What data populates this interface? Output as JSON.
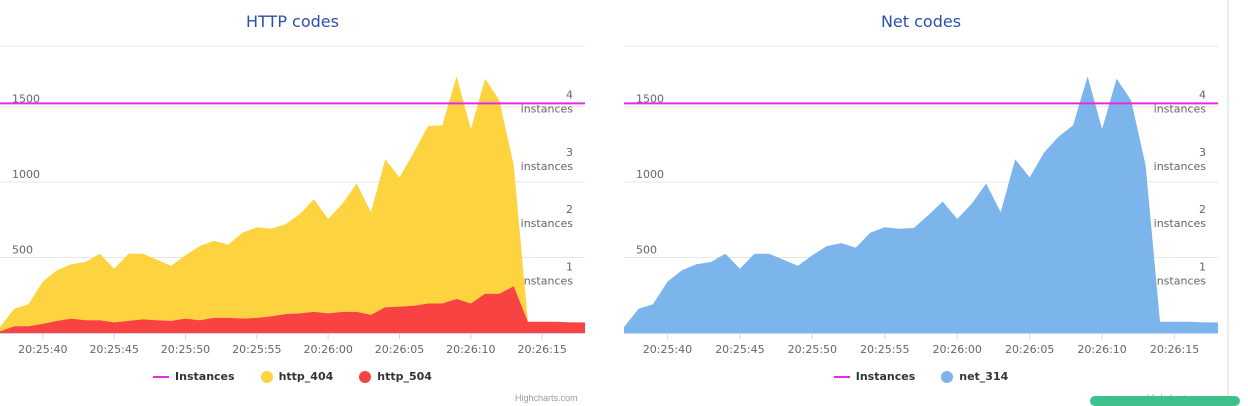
{
  "chart_data": [
    {
      "type": "area",
      "title": "HTTP codes",
      "x": [
        "20:25:37",
        "20:25:38",
        "20:25:39",
        "20:25:40",
        "20:25:41",
        "20:25:42",
        "20:25:43",
        "20:25:44",
        "20:25:45",
        "20:25:46",
        "20:25:47",
        "20:25:48",
        "20:25:49",
        "20:25:50",
        "20:25:51",
        "20:25:52",
        "20:25:53",
        "20:25:54",
        "20:25:55",
        "20:25:56",
        "20:25:57",
        "20:25:58",
        "20:25:59",
        "20:26:00",
        "20:26:01",
        "20:26:02",
        "20:26:03",
        "20:26:04",
        "20:26:05",
        "20:26:06",
        "20:26:07",
        "20:26:08",
        "20:26:09",
        "20:26:10",
        "20:26:11",
        "20:26:12",
        "20:26:13",
        "20:26:14",
        "20:26:15",
        "20:26:16",
        "20:26:17",
        "20:26:18"
      ],
      "x_ticks": [
        "20:25:40",
        "20:25:45",
        "20:25:50",
        "20:25:55",
        "20:26:00",
        "20:26:05",
        "20:26:10",
        "20:26:15"
      ],
      "y_ticks": [
        "500",
        "1000",
        "1500"
      ],
      "ylim": [
        0,
        1900
      ],
      "stacking": "normal",
      "series": [
        {
          "name": "http_504",
          "color": "#f94242",
          "values": [
            10,
            45,
            45,
            60,
            80,
            95,
            85,
            85,
            70,
            80,
            90,
            85,
            80,
            95,
            85,
            100,
            100,
            95,
            100,
            110,
            125,
            130,
            140,
            130,
            140,
            140,
            120,
            170,
            175,
            180,
            195,
            195,
            225,
            195,
            260,
            260,
            310,
            75,
            75,
            75,
            70,
            70
          ]
        },
        {
          "name": "http_404",
          "color": "#fdd33f",
          "values": [
            30,
            115,
            145,
            280,
            335,
            360,
            385,
            440,
            355,
            445,
            435,
            400,
            365,
            420,
            490,
            510,
            485,
            570,
            600,
            580,
            595,
            655,
            745,
            625,
            715,
            850,
            680,
            980,
            855,
            1015,
            1175,
            1180,
            1474,
            1155,
            1424,
            1280,
            800,
            0,
            0,
            0,
            0,
            0
          ]
        },
        {
          "name": "Instances",
          "color": "#e629e6",
          "type": "line",
          "yaxis": "right",
          "values": [
            4,
            4,
            4,
            4,
            4,
            4,
            4,
            4,
            4,
            4,
            4,
            4,
            4,
            4,
            4,
            4,
            4,
            4,
            4,
            4,
            4,
            4,
            4,
            4,
            4,
            4,
            4,
            4,
            4,
            4,
            4,
            4,
            4,
            4,
            4,
            4,
            4,
            4,
            4,
            4,
            4,
            4
          ]
        }
      ],
      "y2_ticks": [
        {
          "value": "1",
          "unit": "instances"
        },
        {
          "value": "2",
          "unit": "instances"
        },
        {
          "value": "3",
          "unit": "instances"
        },
        {
          "value": "4",
          "unit": "instances"
        }
      ],
      "y2lim": [
        0,
        5
      ],
      "legend": [
        "Instances",
        "http_404",
        "http_504"
      ],
      "credits": "Highcharts.com"
    },
    {
      "type": "area",
      "title": "Net codes",
      "x": [
        "20:25:37",
        "20:25:38",
        "20:25:39",
        "20:25:40",
        "20:25:41",
        "20:25:42",
        "20:25:43",
        "20:25:44",
        "20:25:45",
        "20:25:46",
        "20:25:47",
        "20:25:48",
        "20:25:49",
        "20:25:50",
        "20:25:51",
        "20:25:52",
        "20:25:53",
        "20:25:54",
        "20:25:55",
        "20:25:56",
        "20:25:57",
        "20:25:58",
        "20:25:59",
        "20:26:00",
        "20:26:01",
        "20:26:02",
        "20:26:03",
        "20:26:04",
        "20:26:05",
        "20:26:06",
        "20:26:07",
        "20:26:08",
        "20:26:09",
        "20:26:10",
        "20:26:11",
        "20:26:12",
        "20:26:13",
        "20:26:14",
        "20:26:15",
        "20:26:16",
        "20:26:17",
        "20:26:18"
      ],
      "x_ticks": [
        "20:25:40",
        "20:25:45",
        "20:25:50",
        "20:25:55",
        "20:26:00",
        "20:26:05",
        "20:26:10",
        "20:26:15"
      ],
      "y_ticks": [
        "500",
        "1000",
        "1500"
      ],
      "ylim": [
        0,
        1900
      ],
      "series": [
        {
          "name": "net_314",
          "color": "#7cb5ec",
          "values": [
            40,
            160,
            190,
            340,
            415,
            455,
            470,
            525,
            425,
            525,
            525,
            485,
            445,
            515,
            575,
            595,
            565,
            665,
            700,
            690,
            695,
            780,
            870,
            755,
            855,
            990,
            800,
            1150,
            1030,
            1195,
            1300,
            1375,
            1699,
            1350,
            1684,
            1540,
            1110,
            75,
            75,
            75,
            70,
            70
          ]
        },
        {
          "name": "Instances",
          "color": "#e629e6",
          "type": "line",
          "yaxis": "right",
          "values": [
            4,
            4,
            4,
            4,
            4,
            4,
            4,
            4,
            4,
            4,
            4,
            4,
            4,
            4,
            4,
            4,
            4,
            4,
            4,
            4,
            4,
            4,
            4,
            4,
            4,
            4,
            4,
            4,
            4,
            4,
            4,
            4,
            4,
            4,
            4,
            4,
            4,
            4,
            4,
            4,
            4,
            4
          ]
        }
      ],
      "y2_ticks": [
        {
          "value": "1",
          "unit": "instances"
        },
        {
          "value": "2",
          "unit": "instances"
        },
        {
          "value": "3",
          "unit": "instances"
        },
        {
          "value": "4",
          "unit": "instances"
        }
      ],
      "y2lim": [
        0,
        5
      ],
      "legend": [
        "Instances",
        "net_314"
      ],
      "credits": "Highcharts.com"
    }
  ]
}
